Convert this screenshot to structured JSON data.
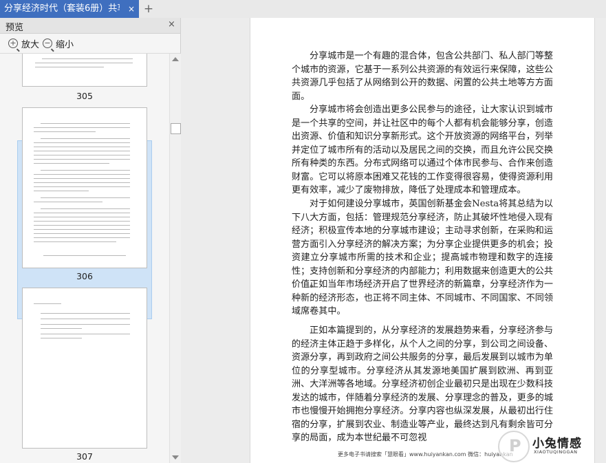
{
  "tab": {
    "title": "分享经济时代（套装6册）共享经",
    "close_icon": "×",
    "new_tab_icon": "+"
  },
  "sidebar": {
    "title": "预览",
    "close_icon": "×",
    "zoom_in_label": "放大",
    "zoom_out_label": "缩小",
    "pages": [
      {
        "number": "305"
      },
      {
        "number": "306",
        "selected": true
      },
      {
        "number": "307"
      }
    ]
  },
  "document": {
    "paragraphs": [
      "分享城市是一个有趣的混合体，包含公共部门、私人部门等整个城市的资源，它基于一系列公共资源的有效运行来保障，这些公共资源几乎包括了从网络到公开的数据、闲置的公共土地等方方面面。",
      "分享城市将会创造出更多公民参与的途径，让大家认识到城市是一个共享的空间，并让社区中的每个人都有机会能够分享，创造出资源、价值和知识分享新形式。这个开放资源的网络平台，列举并定位了城市所有的活动以及居民之间的交换，而且允许公民交换所有种类的东西。分布式网络可以通过个体市民参与、合作来创造财富。它可以将原本困难又花钱的工作变得很容易，使得资源利用更有效率，减少了废物排放，降低了处理成本和管理成本。",
      "对于如何建设分享城市，英国创新基金会Nesta将其总结为以下八大方面，包括：管理规范分享经济，防止其破坏性地侵入现有经济；积极宣传本地的分享城市建设；主动寻求创新，在采购和运营方面引入分享经济的解决方案；为分享企业提供更多的机会；投资建立分享城市所需的技术和企业；提高城市物理和数字的连接性；支持创新和分享经济的内部能力；利用数据来创造更大的公共价值。",
      "正如当年市场经济开启了世界经济的新篇章，分享经济作为一种新的经济形态，也正将不同主体、不同城市、不同国家、不同领域席卷其中。",
      "正如本篇提到的，从分享经济的发展趋势来看，分享经济参与的经济主体正趋于多样化，从个人之间的分享，到公司之间设备、资源分享，再到政府之间公共服务的分享，最后发展到以城市为单位的分享型城市。分享经济从其发源地美国扩展到欧洲、再到亚洲、大洋洲等各地域。分享经济初创企业最初只是出现在少数科技发达的城市，伴随着分享经济的发展、分享理念的普及，更多的城市也慢慢开始拥抱分享经济。分享内容也纵深发展，从最初出行住宿的分享，扩展到农业、制造业等产业，最终达到凡有剩余皆可分享的局面，成为本世纪最不可忽视"
    ],
    "footer": "更多电子书请搜索「慧眼看」www.huiyankan.com    微信：huiyankan"
  },
  "watermark": {
    "brand": "小兔情感",
    "sub": "XIAOTUQINGGAN"
  }
}
